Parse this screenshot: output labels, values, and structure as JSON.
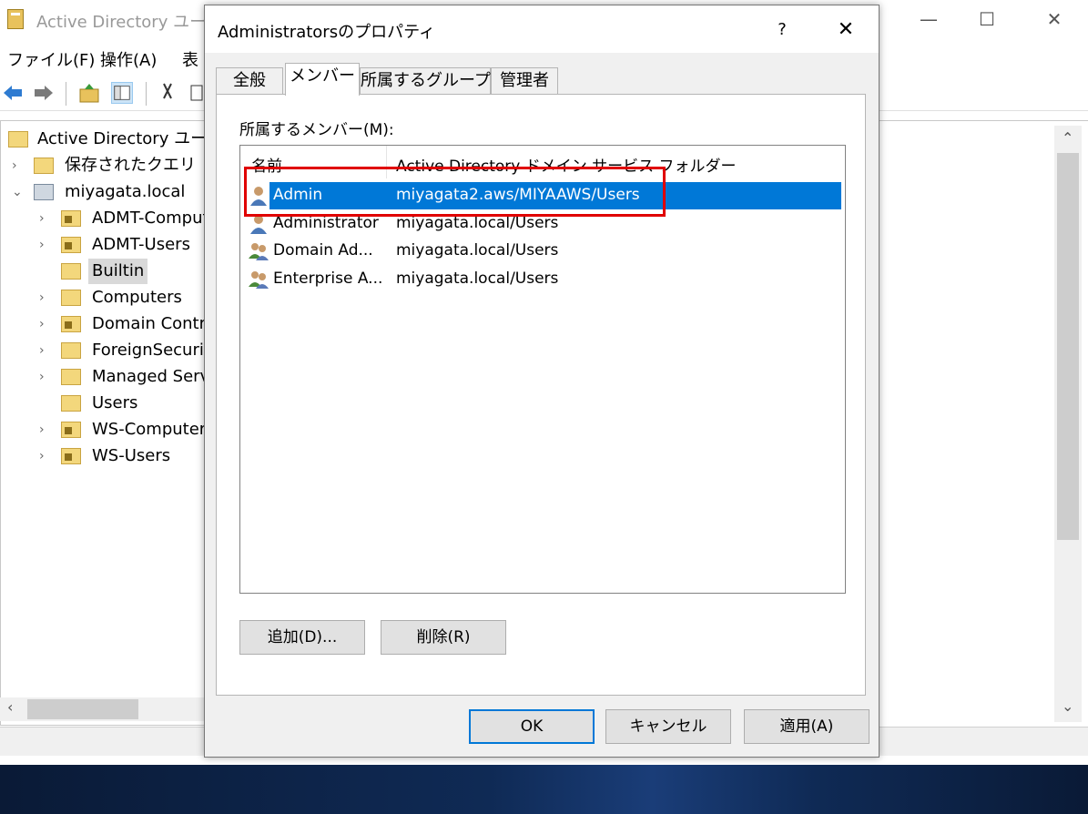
{
  "mmc": {
    "title": "Active Directory ユーザ",
    "controls": {
      "minimize": "—",
      "maximize": "☐",
      "close": "✕"
    },
    "menu": [
      "ファイル(F)",
      "操作(A)",
      "表"
    ],
    "tree": [
      {
        "label": "Active Directory ユーザ",
        "expander": "",
        "icon": "root"
      },
      {
        "label": "保存されたクエリ",
        "expander": "›",
        "icon": "folder"
      },
      {
        "label": "miyagata.local",
        "expander": "⌄",
        "icon": "domain"
      },
      {
        "label": "ADMT-Comput",
        "expander": "›",
        "icon": "ou"
      },
      {
        "label": "ADMT-Users",
        "expander": "›",
        "icon": "ou"
      },
      {
        "label": "Builtin",
        "expander": "",
        "icon": "folder"
      },
      {
        "label": "Computers",
        "expander": "›",
        "icon": "folder"
      },
      {
        "label": "Domain Contro",
        "expander": "›",
        "icon": "ou"
      },
      {
        "label": "ForeignSecurit",
        "expander": "›",
        "icon": "folder"
      },
      {
        "label": "Managed Servi",
        "expander": "›",
        "icon": "folder"
      },
      {
        "label": "Users",
        "expander": "",
        "icon": "folder"
      },
      {
        "label": "WS-Computers",
        "expander": "›",
        "icon": "ou"
      },
      {
        "label": "WS-Users",
        "expander": "›",
        "icon": "ou"
      }
    ],
    "scroll_up": "⌃",
    "scroll_down": "⌄",
    "scroll_left": "‹"
  },
  "dialog": {
    "title": "Administratorsのプロパティ",
    "help": "?",
    "close": "✕",
    "tabs": [
      "全般",
      "メンバー",
      "所属するグループ",
      "管理者"
    ],
    "active_tab": "メンバー",
    "members_label": "所属するメンバー(M):",
    "columns": [
      "名前",
      "Active Directory ドメイン サービス フォルダー"
    ],
    "members": [
      {
        "name": "Admin",
        "folder": "miyagata2.aws/MIYAAWS/Users",
        "icon": "user-icon",
        "selected": true
      },
      {
        "name": "Administrator",
        "folder": "miyagata.local/Users",
        "icon": "user-icon",
        "selected": false
      },
      {
        "name": "Domain Ad...",
        "folder": "miyagata.local/Users",
        "icon": "group-icon",
        "selected": false
      },
      {
        "name": "Enterprise A...",
        "folder": "miyagata.local/Users",
        "icon": "group-icon",
        "selected": false
      }
    ],
    "add_button": "追加(D)...",
    "remove_button": "削除(R)",
    "ok_button": "OK",
    "cancel_button": "キャンセル",
    "apply_button": "適用(A)"
  },
  "colors": {
    "selection": "#0078d7",
    "highlight_box": "#e00000",
    "dialog_bg": "#f0f0f0"
  }
}
